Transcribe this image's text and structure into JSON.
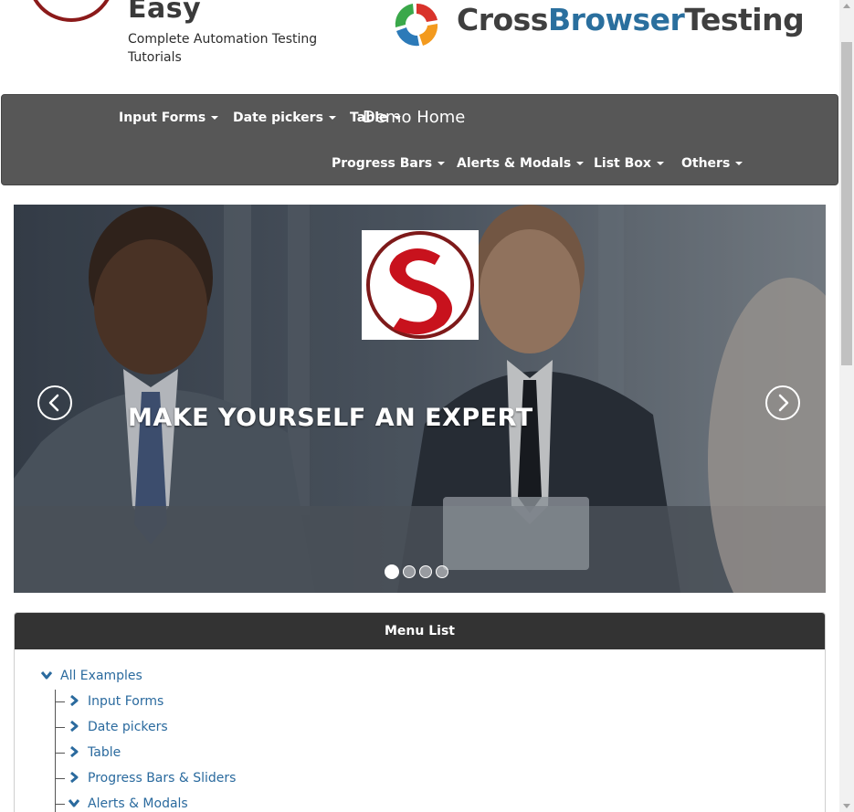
{
  "header": {
    "brand_word": "Easy",
    "tagline": "Complete Automation Testing Tutorials",
    "partner": {
      "part1": "Cross",
      "part2": "Browser",
      "part3": "Testing"
    }
  },
  "navbar": {
    "brand": "Demo Home",
    "row1": [
      "Input Forms",
      "Date pickers",
      "Table"
    ],
    "row2": [
      "Progress Bars",
      "Alerts & Modals",
      "List Box",
      "Others"
    ]
  },
  "carousel": {
    "caption": "MAKE YOURSELF AN EXPERT",
    "slide_count": 4,
    "active_index": 0,
    "prev_icon": "chevron-left-icon",
    "next_icon": "chevron-right-icon"
  },
  "menu": {
    "title": "Menu List",
    "root": "All Examples",
    "items": [
      "Input Forms",
      "Date pickers",
      "Table",
      "Progress Bars & Sliders",
      "Alerts & Modals"
    ]
  },
  "colors": {
    "navbar_bg": "#575757",
    "panel_head_bg": "#333333",
    "link": "#2a6a9e",
    "brand_blue": "#2a6f9e",
    "logo_red": "#c8121d"
  }
}
